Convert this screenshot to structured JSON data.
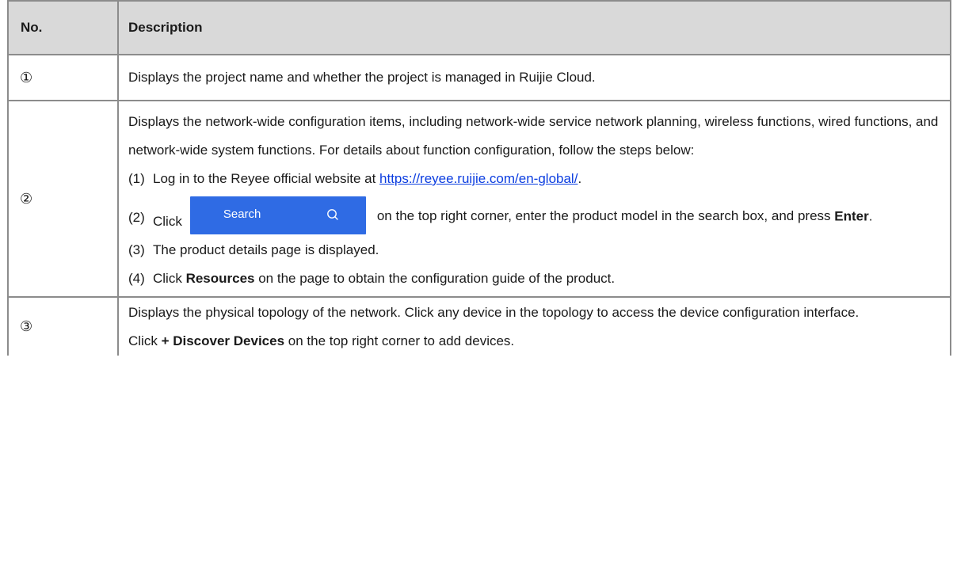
{
  "header": {
    "no": "No.",
    "description": "Description"
  },
  "rows": [
    {
      "num": "①",
      "text": "Displays the project name and whether the project is managed in Ruijie Cloud."
    },
    {
      "num": "②",
      "intro": "Displays the network-wide configuration items, including network-wide service network planning, wireless functions, wired functions, and network-wide system functions. For details about function configuration, follow the steps below:",
      "step1": {
        "n": "(1)",
        "pre": "Log in to the Reyee official website at ",
        "link": "https://reyee.ruijie.com/en-global/",
        "post": "."
      },
      "step2": {
        "n": "(2)",
        "pre": "Click",
        "button_label": "Search",
        "button_icon": "search-icon",
        "mid": "on the top right corner, enter the product model in the search box, and press ",
        "bold": "Enter",
        "post": "."
      },
      "step3": {
        "n": "(3)",
        "text": "The product details page is displayed."
      },
      "step4": {
        "n": "(4)",
        "pre": "Click ",
        "bold": "Resources",
        "post": " on the page to obtain the configuration guide of the product."
      }
    },
    {
      "num": "③",
      "line1": "Displays the physical topology of the network. Click any device in the topology to access the device configuration interface.",
      "line2": {
        "pre": "Click ",
        "bold": "+ Discover Devices",
        "post": " on the top right corner to add devices."
      }
    }
  ],
  "colors": {
    "header_bg": "#d9d9d9",
    "border": "#8c8c8c",
    "button_bg": "#2f6be4",
    "link": "#0b3de0"
  }
}
